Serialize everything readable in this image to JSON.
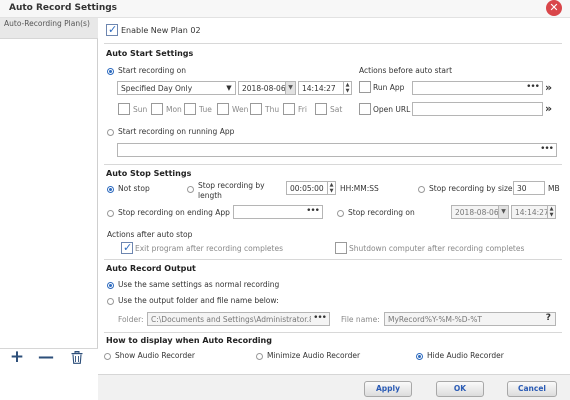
{
  "window": {
    "title": "Auto Record Settings",
    "close_icon": "close-icon"
  },
  "sidebar": {
    "items": [
      {
        "label": "Auto-Recording Plan(s)"
      }
    ],
    "tools": {
      "add": "+",
      "remove": "—",
      "delete_icon": "trash-icon"
    }
  },
  "plan": {
    "enable_label": "Enable New Plan 02",
    "enabled": true
  },
  "auto_start": {
    "heading": "Auto Start Settings",
    "start_recording_on": "Start recording on",
    "day_mode": "Specified Day Only",
    "date": "2018-08-06",
    "time": "14:14:27",
    "days": [
      "Sun",
      "Mon",
      "Tue",
      "Wen",
      "Thu",
      "Fri",
      "Sat"
    ],
    "actions_before": "Actions before auto start",
    "run_app": "Run App",
    "open_url": "Open URL",
    "start_on_app": "Start recording on running App"
  },
  "auto_stop": {
    "heading": "Auto Stop Settings",
    "not_stop": "Not stop",
    "stop_by_length": "Stop recording by length",
    "length_value": "00:05:00",
    "length_unit": "HH:MM:SS",
    "stop_by_size": "Stop recording by size",
    "size_value": "30",
    "size_unit": "MB",
    "stop_on_ending_app": "Stop recording on ending App",
    "stop_on": "Stop recording on",
    "stop_date": "2018-08-06",
    "stop_time": "14:14:27",
    "actions_after": "Actions after auto stop",
    "exit_program": "Exit program after recording completes",
    "shutdown": "Shutdown computer after recording completes"
  },
  "output": {
    "heading": "Auto Record Output",
    "same_settings": "Use the same settings as normal recording",
    "use_output_folder": "Use the output folder and file name below:",
    "folder_label": "Folder:",
    "folder_value": "C:\\Documents and Settings\\Administrator.8:",
    "file_label": "File name:",
    "file_value": "MyRecord%Y-%M-%D-%T",
    "help": "?"
  },
  "display": {
    "heading": "How to display when Auto Recording",
    "show": "Show Audio Recorder",
    "minimize": "Minimize Audio Recorder",
    "hide": "Hide Audio Recorder"
  },
  "buttons": {
    "apply": "Apply",
    "ok": "OK",
    "cancel": "Cancel"
  },
  "colors": {
    "accent": "#2e6bbf",
    "close": "#d9464a",
    "button_text": "#2a5bb5"
  }
}
